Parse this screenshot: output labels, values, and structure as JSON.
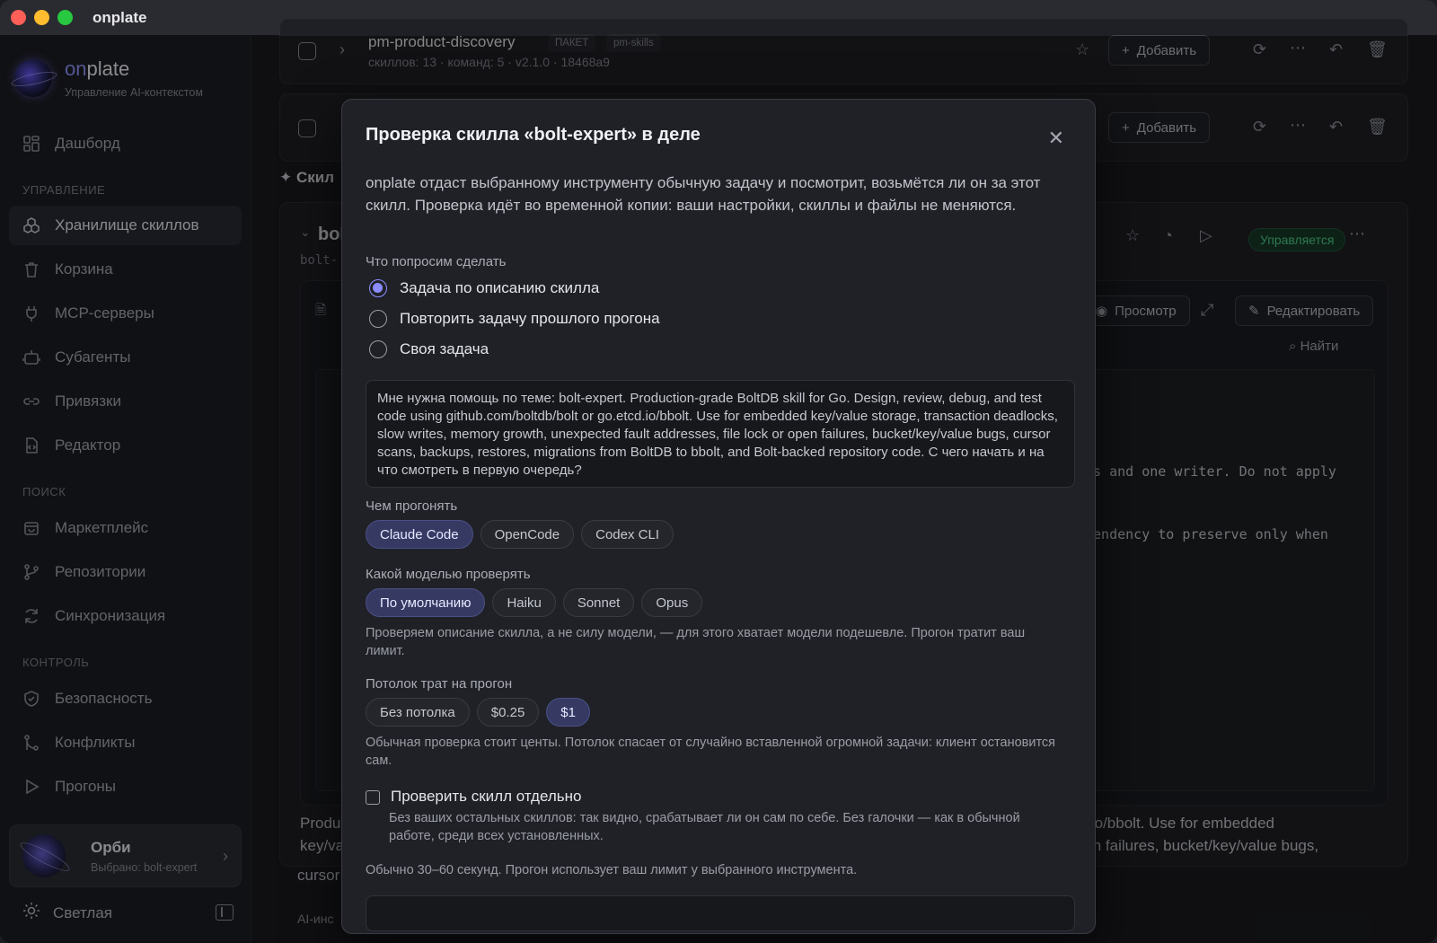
{
  "window": {
    "title": "onplate"
  },
  "brand": {
    "name_prefix": "on",
    "name_suffix": "plate",
    "subtitle": "Управление AI-контекстом"
  },
  "sidebar": {
    "dashboard": "Дашборд",
    "sections": {
      "manage": "УПРАВЛЕНИЕ",
      "search": "ПОИСК",
      "control": "КОНТРОЛЬ"
    },
    "items": [
      {
        "label": "Хранилище скиллов",
        "icon": "cubes-icon"
      },
      {
        "label": "Корзина",
        "icon": "trash-icon"
      },
      {
        "label": "MCP-серверы",
        "icon": "plug-icon"
      },
      {
        "label": "Субагенты",
        "icon": "robot-icon"
      },
      {
        "label": "Привязки",
        "icon": "link-icon"
      },
      {
        "label": "Редактор",
        "icon": "code-file-icon"
      },
      {
        "label": "Маркетплейс",
        "icon": "store-icon"
      },
      {
        "label": "Репозитории",
        "icon": "git-branch-icon"
      },
      {
        "label": "Синхронизация",
        "icon": "sync-icon"
      },
      {
        "label": "Безопасность",
        "icon": "shield-icon"
      },
      {
        "label": "Конфликты",
        "icon": "merge-icon"
      },
      {
        "label": "Прогоны",
        "icon": "play-icon"
      }
    ],
    "assistant": {
      "name": "Орби",
      "subtitle": "Выбрано: bolt-expert"
    },
    "theme_label": "Светлая"
  },
  "background": {
    "package_card": {
      "title": "pm-product-discovery",
      "tag": "ПАКЕТ",
      "source": "pm-skills",
      "meta_skills": "скиллов: 13",
      "meta_commands": "команд: 5",
      "version": "v2.1.0",
      "commit": "18468a9",
      "add_label": "Добавить"
    },
    "second_card": {
      "add_label": "Добавить"
    },
    "section_title": "Скил",
    "skill_title": "bol",
    "skill_slug": "bolt-",
    "status": "Управляется",
    "preview_label": "Просмотр",
    "edit_label": "Редактировать",
    "find_label": "Найти",
    "code_frag_1": "rs and one writer. Do not apply",
    "code_frag_2": "pendency to preserve only when",
    "bottom_frag_1": "etcd.io/bbolt. Use for embedded",
    "bottom_frag_2": "r open failures, bucket/key/value bugs,",
    "left_frag": "Produ",
    "left_frag_2": "key/va",
    "left_frag_3": "cursor",
    "left_frag_4": "AI-инс"
  },
  "modal": {
    "title": "Проверка скилла «bolt-expert» в деле",
    "description": "onplate отдаст выбранному инструменту обычную задачу и посмотрит, возьмётся ли он за этот скилл. Проверка идёт во временной копии: ваши настройки, скиллы и файлы не меняются.",
    "what_label": "Что попросим сделать",
    "options": [
      "Задача по описанию скилла",
      "Повторить задачу прошлого прогона",
      "Своя задача"
    ],
    "selected_option": 0,
    "task_text": "Мне нужна помощь по теме: bolt-expert. Production-grade BoltDB skill for Go. Design, review, debug, and test code using github.com/boltdb/bolt or go.etcd.io/bbolt. Use for embedded key/value storage, transaction deadlocks, slow writes, memory growth, unexpected fault addresses, file lock or open failures, bucket/key/value bugs, cursor scans, backups, restores, migrations from BoltDB to bbolt, and Bolt-backed repository code. С чего начать и на что смотреть в первую очередь?",
    "runner_label": "Чем прогонять",
    "runners": [
      "Claude Code",
      "OpenCode",
      "Codex CLI"
    ],
    "runner_selected": 0,
    "model_label": "Какой моделью проверять",
    "models": [
      "По умолчанию",
      "Haiku",
      "Sonnet",
      "Opus"
    ],
    "model_selected": 0,
    "model_hint": "Проверяем описание скилла, а не силу модели, — для этого хватает модели подешевле. Прогон тратит ваш лимит.",
    "budget_label": "Потолок трат на прогон",
    "budgets": [
      "Без потолка",
      "$0.25",
      "$1"
    ],
    "budget_selected": 2,
    "budget_hint": "Обычная проверка стоит центы. Потолок спасает от случайно вставленной огромной задачи: клиент остановится сам.",
    "isolate_label": "Проверить скилл отдельно",
    "isolate_hint": "Без ваших остальных скиллов: так видно, срабатывает ли он сам по себе. Без галочки — как в обычной работе, среди всех установленных.",
    "duration_hint": "Обычно 30–60 секунд. Прогон использует ваш лимит у выбранного инструмента."
  },
  "colors": {
    "accent": "#8a8cff",
    "status_green": "#4fcf8b",
    "chip_selected": "#363a63"
  }
}
